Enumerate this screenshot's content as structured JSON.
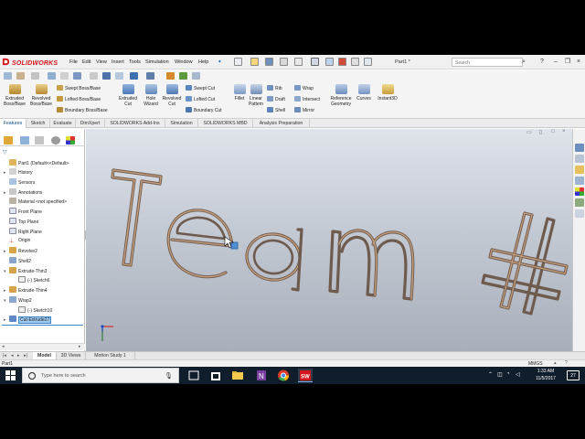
{
  "app": {
    "logo": "SOLIDWORKS",
    "menus": [
      "File",
      "Edit",
      "View",
      "Insert",
      "Tools",
      "Simulation",
      "Window",
      "Help"
    ],
    "document_title": "Part1 *",
    "search_placeholder": "Search"
  },
  "command_manager": {
    "big_buttons": [
      {
        "label": "Extruded\nBoss/Base",
        "icon": "extruded-boss-icon"
      },
      {
        "label": "Revolved\nBoss/Base",
        "icon": "revolved-boss-icon"
      },
      {
        "label": "Extruded\nCut",
        "icon": "extruded-cut-icon"
      },
      {
        "label": "Hole\nWizard",
        "icon": "hole-wizard-icon"
      },
      {
        "label": "Revolved\nCut",
        "icon": "revolved-cut-icon"
      },
      {
        "label": "Fillet",
        "icon": "fillet-icon"
      },
      {
        "label": "Linear\nPattern",
        "icon": "linear-pattern-icon"
      },
      {
        "label": "Reference\nGeometry",
        "icon": "reference-geometry-icon"
      },
      {
        "label": "Curves",
        "icon": "curves-icon"
      },
      {
        "label": "Instant3D",
        "icon": "instant3d-icon"
      }
    ],
    "small_buttons": {
      "swept_boss": "Swept Boss/Base",
      "lofted_boss": "Lofted Boss/Base",
      "boundary_boss": "Boundary Boss/Base",
      "swept_cut": "Swept Cut",
      "lofted_cut": "Lofted Cut",
      "boundary_cut": "Boundary Cut",
      "rib": "Rib",
      "draft": "Draft",
      "shell": "Shell",
      "wrap": "Wrap",
      "intersect": "Intersect",
      "mirror": "Mirror"
    }
  },
  "tabs": [
    "Features",
    "Sketch",
    "Evaluate",
    "DimXpert",
    "SOLIDWORKS Add-Ins",
    "Simulation",
    "SOLIDWORKS MBD",
    "Analysis Preparation"
  ],
  "active_tab": "Features",
  "feature_tree": [
    {
      "label": "Part1  (Default<<Default>",
      "icon": "part-icon",
      "expander": ""
    },
    {
      "label": "History",
      "icon": "history-icon",
      "expander": "▸"
    },
    {
      "label": "Sensors",
      "icon": "sensors-icon",
      "expander": ""
    },
    {
      "label": "Annotations",
      "icon": "annotations-icon",
      "expander": "▸"
    },
    {
      "label": "Material <not specified>",
      "icon": "material-icon",
      "expander": ""
    },
    {
      "label": "Front Plane",
      "icon": "plane-icon",
      "expander": ""
    },
    {
      "label": "Top Plane",
      "icon": "plane-icon",
      "expander": ""
    },
    {
      "label": "Right Plane",
      "icon": "plane-icon",
      "expander": ""
    },
    {
      "label": "Origin",
      "icon": "origin-icon",
      "expander": ""
    },
    {
      "label": "Revolve2",
      "icon": "revolve-icon",
      "expander": "▸"
    },
    {
      "label": "Shell2",
      "icon": "shell-icon",
      "expander": ""
    },
    {
      "label": "Extrude-Thin3",
      "icon": "extrude-icon",
      "expander": "▾"
    },
    {
      "label": "(-) Sketch6",
      "icon": "sketch-icon",
      "expander": ""
    },
    {
      "label": "Extrude-Thin4",
      "icon": "extrude-icon",
      "expander": "▸"
    },
    {
      "label": "Wrap2",
      "icon": "wrap-icon",
      "expander": "▾"
    },
    {
      "label": "(-) Sketch10",
      "icon": "sketch-icon",
      "expander": ""
    },
    {
      "label": "Cut-Extrude27",
      "icon": "cut-extrude-icon",
      "expander": "▸",
      "selected": true
    }
  ],
  "bottom_tabs": [
    "Model",
    "3D Views",
    "Motion Study 1"
  ],
  "active_bottom_tab": "Model",
  "status": {
    "left": "Part1",
    "units": "MMGS"
  },
  "taskbar": {
    "search_placeholder": "Type here to search",
    "time": "1:33 AM",
    "date": "11/5/2017",
    "notification_count": "27"
  },
  "colors": {
    "brand": "#d4151b",
    "accent": "#0a4c8c",
    "selection": "#9fcaf0",
    "taskbar": "#101d2b"
  }
}
